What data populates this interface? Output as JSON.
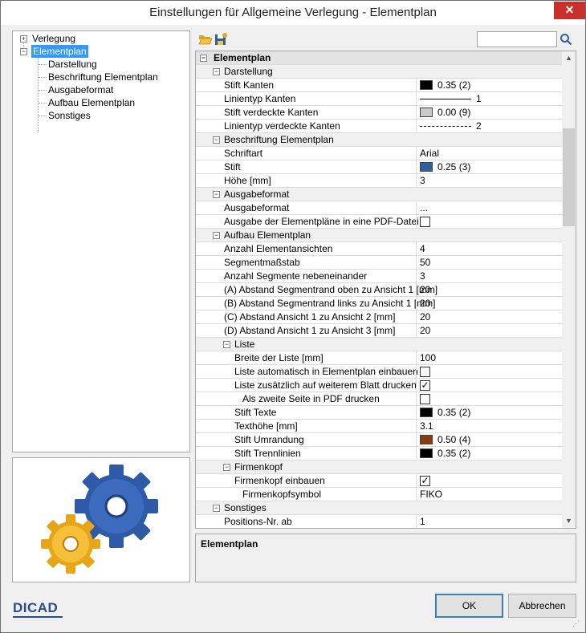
{
  "window": {
    "title": "Einstellungen für Allgemeine Verlegung - Elementplan",
    "close_label": "✕"
  },
  "tree": {
    "items": [
      {
        "label": "Verlegung",
        "expander": "+"
      },
      {
        "label": "Elementplan",
        "expander": "−"
      },
      {
        "label": "Darstellung"
      },
      {
        "label": "Beschriftung Elementplan"
      },
      {
        "label": "Ausgabeformat"
      },
      {
        "label": "Aufbau Elementplan"
      },
      {
        "label": "Sonstiges"
      }
    ]
  },
  "toolbar": {
    "open_icon": "folder-open-icon",
    "save_icon": "save-icon",
    "search_placeholder": ""
  },
  "grid": {
    "root": "Elementplan",
    "rows": {
      "darstellung": "Darstellung",
      "stift_kanten": [
        "Stift Kanten",
        "0.35 (2)"
      ],
      "linientyp_kanten": [
        "Linientyp Kanten",
        "1"
      ],
      "stift_verdeckt": [
        "Stift verdeckte Kanten",
        "0.00 (9)"
      ],
      "linientyp_verdeckt": [
        "Linientyp verdeckte Kanten",
        "2"
      ],
      "beschriftung": "Beschriftung Elementplan",
      "schriftart": [
        "Schriftart",
        "Arial"
      ],
      "stift": [
        "Stift",
        "0.25 (3)"
      ],
      "hoehe": [
        "Höhe [mm]",
        "3"
      ],
      "ausgabeformat_cat": "Ausgabeformat",
      "ausgabeformat": [
        "Ausgabeformat",
        "..."
      ],
      "ausgabe_pdf": [
        "Ausgabe der Elementpläne in eine PDF-Datei",
        ""
      ],
      "aufbau": "Aufbau Elementplan",
      "anzahl_ansichten": [
        "Anzahl Elementansichten",
        "4"
      ],
      "segmentmassstab": [
        "Segmentmaßstab",
        "50"
      ],
      "anzahl_segmente": [
        "Anzahl Segmente nebeneinander",
        "3"
      ],
      "abstand_a": [
        "(A) Abstand Segmentrand oben zu Ansicht 1 [mm]",
        "20"
      ],
      "abstand_b": [
        "(B) Abstand Segmentrand links zu Ansicht 1 [mm]",
        "20"
      ],
      "abstand_c": [
        "(C) Abstand Ansicht 1 zu Ansicht 2 [mm]",
        "20"
      ],
      "abstand_d": [
        "(D) Abstand Ansicht 1 zu Ansicht 3 [mm]",
        "20"
      ],
      "liste": "Liste",
      "breite_liste": [
        "Breite der Liste [mm]",
        "100"
      ],
      "liste_auto": [
        "Liste automatisch in Elementplan einbauen",
        ""
      ],
      "liste_blatt": [
        "Liste zusätzlich auf weiterem Blatt drucken",
        "✓"
      ],
      "zweite_seite": [
        "Als zweite Seite in PDF drucken",
        ""
      ],
      "stift_texte": [
        "Stift Texte",
        "0.35 (2)"
      ],
      "texthoehe": [
        "Texthöhe [mm]",
        "3.1"
      ],
      "stift_umrandung": [
        "Stift Umrandung",
        "0.50 (4)"
      ],
      "stift_trennlinien": [
        "Stift Trennlinien",
        "0.35 (2)"
      ],
      "firmenkopf": "Firmenkopf",
      "firmenkopf_einbauen": [
        "Firmenkopf einbauen",
        "✓"
      ],
      "firmenkopfsymbol": [
        "Firmenkopfsymbol",
        "FIKO"
      ],
      "sonstiges": "Sonstiges",
      "positions_nr": [
        "Positions-Nr. ab",
        "1"
      ]
    },
    "expander_minus": "−"
  },
  "colors": {
    "black": "#000000",
    "grey": "#c8c8c8",
    "blue": "#2f5f9c",
    "brown": "#8b3a0c",
    "selection": "#3399ff"
  },
  "description": {
    "title": "Elementplan"
  },
  "buttons": {
    "ok": "OK",
    "cancel": "Abbrechen"
  },
  "brand": {
    "name": "DICAD"
  }
}
